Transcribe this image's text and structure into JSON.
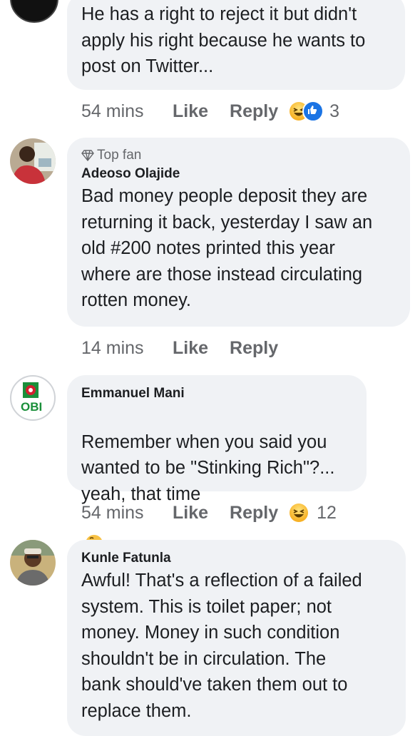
{
  "comments": [
    {
      "text": "He has a right to reject it but didn't\napply his right because he wants to\npost on Twitter...",
      "time": "54 mins",
      "like": "Like",
      "reply": "Reply",
      "reaction_count": "3",
      "reactions": [
        "haha-icon",
        "like-icon"
      ]
    },
    {
      "badge": "Top fan",
      "author": "Adeoso Olajide",
      "text": "Bad money people deposit they are\nreturning it back, yesterday I saw an\nold #200 notes printed this year\nwhere are those instead circulating\nrotten money.",
      "time": "14 mins",
      "like": "Like",
      "reply": "Reply"
    },
    {
      "author": "Emmanuel Mani",
      "avatar_text": "OBI",
      "text": "Remember when you said you\nwanted to be \"Stinking Rich\"?...\nyeah, that time",
      "trailing_emoji": "thinking-face-icon",
      "time": "54 mins",
      "like": "Like",
      "reply": "Reply",
      "reaction_count": "12",
      "reactions": [
        "haha-icon"
      ]
    },
    {
      "author": "Kunle Fatunla",
      "text": "Awful! That's a reflection of a failed\nsystem. This is toilet paper; not\nmoney. Money in such condition\nshouldn't be in circulation. The\nbank should've taken them out to\nreplace them."
    }
  ],
  "colors": {
    "bubble": "#f0f2f5",
    "muted": "#65676b",
    "text": "#1c1e21",
    "like_blue": "#1b74e4",
    "haha_yellow": "#f7b125",
    "obi_green": "#1a8f3a",
    "obi_red": "#d3202f"
  }
}
